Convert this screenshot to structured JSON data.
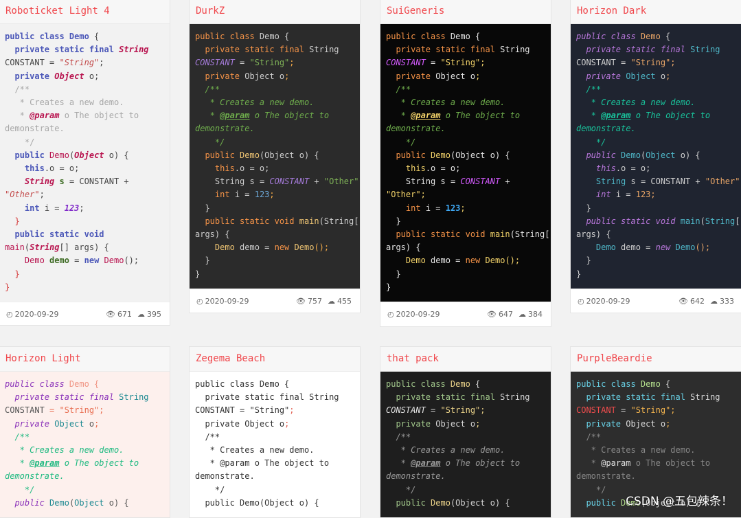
{
  "themes": [
    {
      "title": "Roboticket Light 4",
      "date": "2020-09-29",
      "views": "671",
      "downloads": "395"
    },
    {
      "title": "DurkZ",
      "date": "2020-09-29",
      "views": "757",
      "downloads": "455"
    },
    {
      "title": "SuiGeneris",
      "date": "2020-09-29",
      "views": "647",
      "downloads": "384"
    },
    {
      "title": "Horizon Dark",
      "date": "2020-09-29",
      "views": "642",
      "downloads": "333"
    },
    {
      "title": "Horizon Light"
    },
    {
      "title": "Zegema Beach"
    },
    {
      "title": "that pack"
    },
    {
      "title": "PurpleBeardie"
    }
  ],
  "code": {
    "public_class": "public class ",
    "demo": "Demo",
    "brace_open": " {",
    "private_static_final": "private static final ",
    "string_type": "String",
    "constant": "CONSTANT",
    "assign_eq": " = ",
    "string_lit": "\"String\"",
    "semi": ";",
    "private_kw": "private ",
    "object_type": "Object",
    "o_var": " o",
    "comment_open": "/**",
    "comment_creates": " * Creates a new demo.",
    "comment_star": " * ",
    "param_tag": "@param",
    "param_text": " o The object to",
    "demonstrate": "demonstrate.",
    "comment_close": "  */",
    "public_kw": "public ",
    "demo_params_open": "(",
    "demo_params_arg": " o) {",
    "this_kw": "this",
    "this_rest": ".o = o;",
    "s_var": " s",
    "plus": " +",
    "plus_other": " + ",
    "other_lit": "\"Other\"",
    "int_kw": "int",
    "i_var": " i = ",
    "num": "123",
    "brace_close": "}",
    "public_static_void": "public static void ",
    "main_fn": "main",
    "main_args": "[] args) {",
    "main_args_split": "[]",
    "args_open": "args) {",
    "demo_var": " demo = ",
    "demo_var_bold": " demo",
    "eq_plain": " = ",
    "new_kw": "new",
    "new_tail": "();"
  },
  "watermark": "CSDN @五包辣条！"
}
